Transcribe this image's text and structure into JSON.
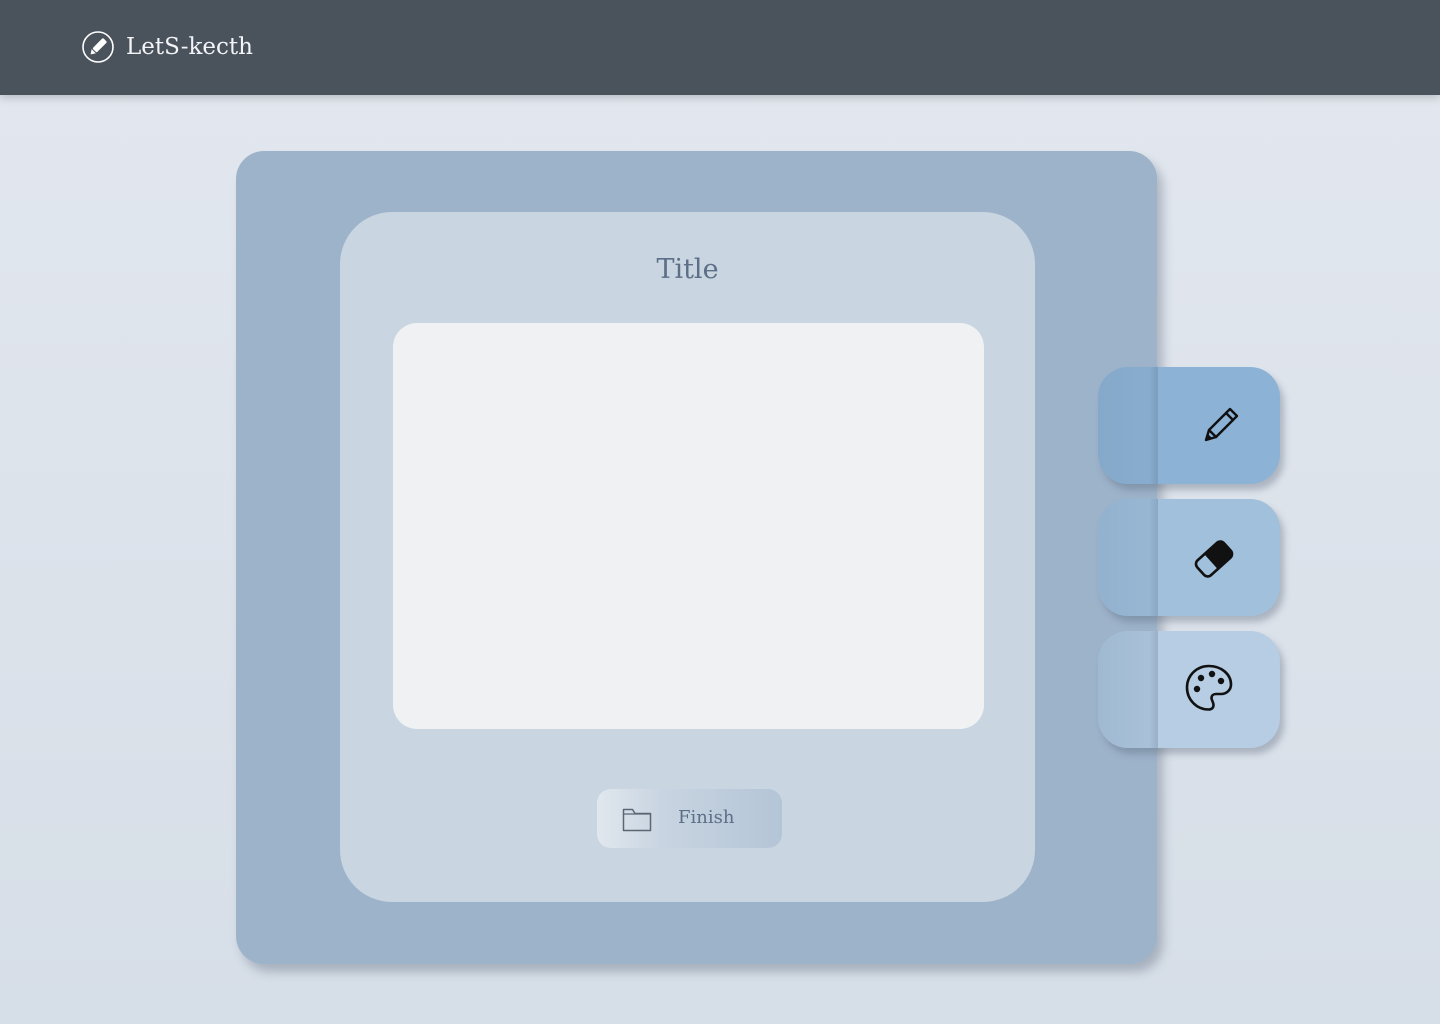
{
  "header": {
    "app_name": "LetS-kecth",
    "logo_icon": "pencil-circle-icon",
    "background_color": "#4a525c"
  },
  "editor": {
    "title": "Title",
    "finish_button": {
      "label": "Finish",
      "icon": "folder-icon"
    }
  },
  "tools": [
    {
      "name": "pencil",
      "icon": "pencil-icon",
      "color": "#8cb3d5"
    },
    {
      "name": "eraser",
      "icon": "eraser-icon",
      "color": "#a0c0dc"
    },
    {
      "name": "palette",
      "icon": "palette-icon",
      "color": "#b6cde3"
    }
  ],
  "colors": {
    "page_background": "#dfe5ed",
    "outer_panel": "#9db3ca",
    "inner_card": "#c9d5e1",
    "canvas": "#eff1f3",
    "text_muted": "#5c6f87"
  }
}
